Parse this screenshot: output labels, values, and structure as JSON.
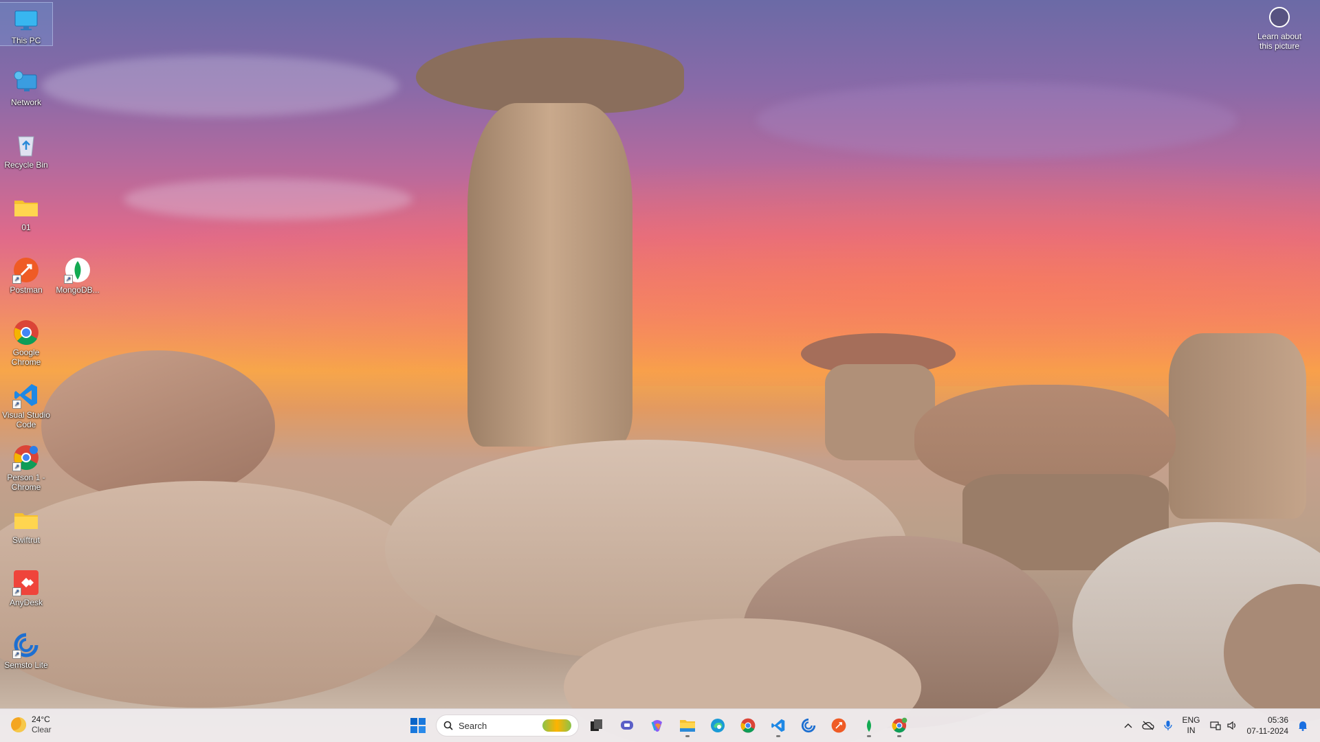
{
  "desktop": {
    "icons": [
      {
        "label": "This PC",
        "icon": "monitor-icon"
      },
      {
        "label": "Network",
        "icon": "network-icon"
      },
      {
        "label": "Recycle Bin",
        "icon": "recycle-bin-icon"
      },
      {
        "label": "01",
        "icon": "folder-icon"
      },
      {
        "label": "Postman",
        "icon": "postman-icon"
      },
      {
        "label": "MongoDB...",
        "icon": "mongodb-icon"
      },
      {
        "label": "Google Chrome",
        "icon": "chrome-icon"
      },
      {
        "label": "Visual Studio Code",
        "icon": "vscode-icon"
      },
      {
        "label": "Person 1 - Chrome",
        "icon": "chrome-profile-icon"
      },
      {
        "label": "Swiftrut",
        "icon": "folder-icon"
      },
      {
        "label": "AnyDesk",
        "icon": "anydesk-icon"
      },
      {
        "label": "Semsto Lite",
        "icon": "semsto-icon"
      }
    ]
  },
  "learn_about": {
    "line1": "Learn about",
    "line2": "this picture",
    "icon": "camera-circle-icon"
  },
  "taskbar": {
    "weather": {
      "temp": "24°C",
      "condition": "Clear",
      "icon": "moon-icon"
    },
    "search": {
      "placeholder": "Search"
    },
    "apps": [
      {
        "name": "start",
        "icon": "windows-start-icon"
      },
      {
        "name": "task-view",
        "icon": "task-view-icon"
      },
      {
        "name": "meet",
        "icon": "meet-icon"
      },
      {
        "name": "copilot",
        "icon": "copilot-icon"
      },
      {
        "name": "file-explorer",
        "icon": "file-explorer-icon"
      },
      {
        "name": "edge",
        "icon": "edge-icon"
      },
      {
        "name": "chrome",
        "icon": "chrome-icon"
      },
      {
        "name": "vscode",
        "icon": "vscode-icon"
      },
      {
        "name": "semsto",
        "icon": "semsto-icon"
      },
      {
        "name": "postman",
        "icon": "postman-icon"
      },
      {
        "name": "mongodb",
        "icon": "mongodb-icon"
      },
      {
        "name": "chrome-profile",
        "icon": "chrome-profile-icon"
      }
    ],
    "tray": {
      "language_line1": "ENG",
      "language_line2": "IN",
      "time": "05:36",
      "date": "07-11-2024"
    }
  },
  "colors": {
    "taskbar_bg": "#eeeaec",
    "accent_blue": "#0a64c8"
  }
}
